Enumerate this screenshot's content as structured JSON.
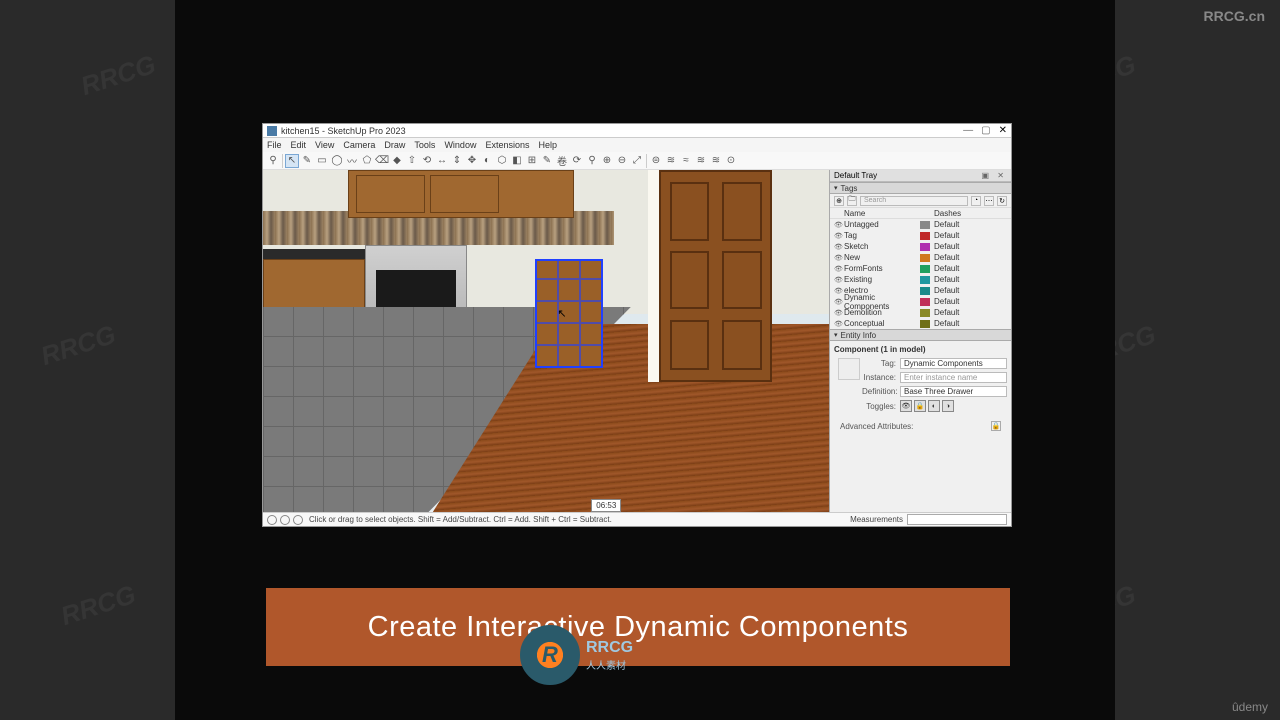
{
  "watermarks": {
    "top_right": "RRCG.cn",
    "diag": "RRCG"
  },
  "app": {
    "title": "kitchen15 - SketchUp Pro 2023",
    "menus": [
      "File",
      "Edit",
      "View",
      "Camera",
      "Draw",
      "Tools",
      "Window",
      "Extensions",
      "Help"
    ]
  },
  "toolbar_icons": [
    "⚲",
    "↖",
    "✎",
    "▭",
    "◯",
    "〰",
    "⬠",
    "⌫",
    "◆",
    "⇧",
    "⟲",
    "↔",
    "⇕",
    "✥",
    "◐",
    "⬡",
    "◧",
    "⊞",
    "✎",
    "卷",
    "⟳",
    "⚲",
    "⊕",
    "⊖",
    "⤢",
    "⊜",
    "≋",
    "≈",
    "≋",
    "≋",
    "⊙"
  ],
  "viewport": {
    "timecode": "06:53"
  },
  "status": {
    "msg": "Click or drag to select objects. Shift = Add/Subtract. Ctrl = Add. Shift + Ctrl = Subtract.",
    "measurements_label": "Measurements"
  },
  "tray": {
    "title": "Default Tray",
    "tags_panel": {
      "title": "Tags",
      "search_placeholder": "Search",
      "cols": {
        "name": "Name",
        "dashes": "Dashes"
      },
      "rows": [
        {
          "name": "Untagged",
          "color": "#888888",
          "dash": "Default"
        },
        {
          "name": "Tag",
          "color": "#c02828",
          "dash": "Default",
          "dim": true
        },
        {
          "name": "Sketch",
          "color": "#b030b0",
          "dash": "Default"
        },
        {
          "name": "New",
          "color": "#d07820",
          "dash": "Default"
        },
        {
          "name": "FormFonts",
          "color": "#20a060",
          "dash": "Default"
        },
        {
          "name": "Existing",
          "color": "#2098a0",
          "dash": "Default"
        },
        {
          "name": "electro",
          "color": "#1a8a8a",
          "dash": "Default"
        },
        {
          "name": "Dynamic Components",
          "color": "#c03058",
          "dash": "Default"
        },
        {
          "name": "Demolition",
          "color": "#8a8a28",
          "dash": "Default",
          "dim": true
        },
        {
          "name": "Conceptual",
          "color": "#707018",
          "dash": "Default",
          "dim": true
        }
      ]
    },
    "entity_panel": {
      "title": "Entity Info",
      "header": "Component (1 in model)",
      "tag_label": "Tag:",
      "tag_value": "Dynamic Components",
      "instance_label": "Instance:",
      "instance_placeholder": "Enter instance name",
      "definition_label": "Definition:",
      "definition_value": "Base Three Drawer",
      "toggles_label": "Toggles:",
      "adv": "Advanced Attributes:"
    }
  },
  "banner": {
    "text": "Create Interactive Dynamic Components"
  },
  "logo": {
    "main": "RRCG",
    "sub": "人人素材"
  },
  "udemy": "ûdemy"
}
